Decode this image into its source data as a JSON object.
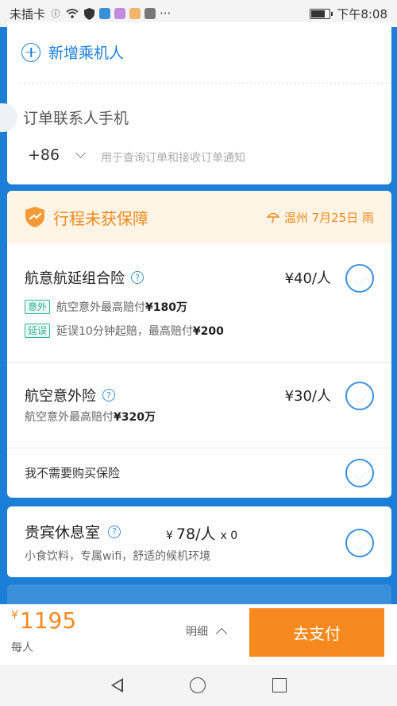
{
  "status_bar": {
    "carrier": "未插卡",
    "time": "下午8:08",
    "dots": "···"
  },
  "passenger": {
    "add_label": "新增乘机人",
    "contact_label": "订单联系人手机",
    "country_code": "+86",
    "phone_placeholder": "用于查询订单和接收订单通知"
  },
  "insurance": {
    "header_title": "行程未获保障",
    "weather": "温州 7月25日 雨",
    "options": [
      {
        "name": "航意航延组合险",
        "price": "¥40/人",
        "details": [
          {
            "tag": "意外",
            "text": "航空意外最高赔付",
            "amount": "¥180万"
          },
          {
            "tag": "延误",
            "text": "延误10分钟起赔，最高赔付",
            "amount": "¥200"
          }
        ]
      },
      {
        "name": "航空意外险",
        "price": "¥30/人",
        "detail_text": "航空意外最高赔付",
        "detail_amount": "¥320万"
      }
    ],
    "none_label": "我不需要购买保险"
  },
  "lounge": {
    "name": "贵宾休息室",
    "yen": "¥",
    "price": "78/人",
    "qty": "x 0",
    "desc": "小食饮料，专属wifi，舒适的候机环境"
  },
  "pay_bar": {
    "currency": "¥",
    "total": "1195",
    "per_person": "每人",
    "detail_label": "明细",
    "pay_label": "去支付"
  },
  "colors": {
    "primary": "#1b7fd8",
    "accent": "#f7891f",
    "warning_bg": "#fff4e5",
    "tag_green": "#2eb398"
  }
}
